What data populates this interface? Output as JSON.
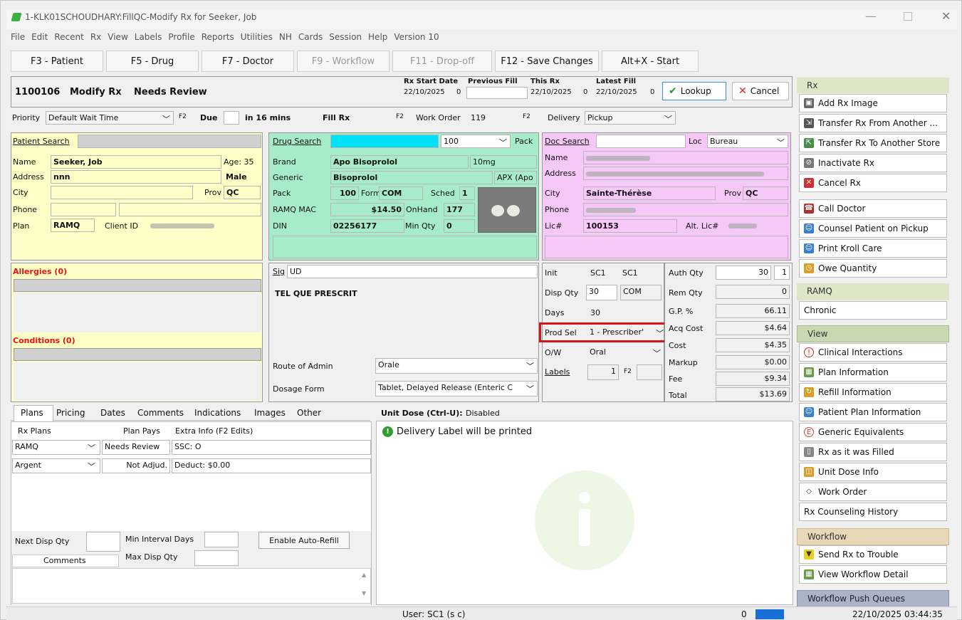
{
  "window": {
    "title": "1-KLK01SCHOUDHARY:FillQC-Modify Rx for Seeker, Job"
  },
  "menu": [
    "File",
    "Edit",
    "Recent",
    "Rx",
    "View",
    "Labels",
    "Profile",
    "Reports",
    "Utilities",
    "NH",
    "Cards",
    "Session",
    "Help",
    "Version 10"
  ],
  "fkeys": [
    "F3 - Patient",
    "F5 - Drug",
    "F7 - Doctor",
    "F9 - Workflow",
    "F11 - Drop-off",
    "F12 - Save Changes",
    "Alt+X - Start"
  ],
  "header": {
    "rx_number": "1100106",
    "mode": "Modify Rx",
    "status": "Needs Review",
    "rx_start_label": "Rx Start Date",
    "rx_start": "22/10/2025",
    "rx_start_n": "0",
    "prev_fill_label": "Previous Fill",
    "this_rx_label": "This Rx",
    "this_rx": "22/10/2025",
    "this_rx_n": "0",
    "latest_fill_label": "Latest Fill",
    "latest_fill": "22/10/2025",
    "latest_fill_n": "0",
    "lookup": "Lookup",
    "cancel": "Cancel"
  },
  "row2": {
    "priority_label": "Priority",
    "priority": "Default Wait Time",
    "f2": "F2",
    "due_label": "Due",
    "due": "in 16 mins",
    "fill_rx": "Fill Rx",
    "work_order_label": "Work Order",
    "work_order": "119",
    "delivery_label": "Delivery",
    "delivery": "Pickup"
  },
  "patient": {
    "search_label": "Patient Search",
    "name_label": "Name",
    "name": "Seeker, Job",
    "age": "Age: 35",
    "address_label": "Address",
    "address": "nnn",
    "sex": "Male",
    "city_label": "City",
    "prov_label": "Prov",
    "prov": "QC",
    "phone_label": "Phone",
    "plan_label": "Plan",
    "plan": "RAMQ",
    "client_id_label": "Client ID"
  },
  "drug": {
    "search_label": "Drug Search",
    "qty": "100",
    "pack_btn": "Pack",
    "brand_label": "Brand",
    "brand": "Apo Bisoprolol",
    "strength": "10mg",
    "generic_label": "Generic",
    "generic": "Bisoprolol",
    "mfr": "APX (Apo",
    "pack_label": "Pack",
    "pack": "100",
    "form_label": "Form",
    "form": "COM",
    "sched_label": "Sched",
    "sched": "1",
    "mac_label": "RAMQ MAC",
    "mac": "$14.50",
    "onhand_label": "OnHand",
    "onhand": "177",
    "din_label": "DIN",
    "din": "02256177",
    "minqty_label": "Min Qty",
    "minqty": "0"
  },
  "doctor": {
    "search_label": "Doc Search",
    "loc_label": "Loc",
    "loc": "Bureau",
    "name_label": "Name",
    "address_label": "Address",
    "city_label": "City",
    "city": "Sainte-Thérèse",
    "prov_label": "Prov",
    "prov": "QC",
    "phone_label": "Phone",
    "lic_label": "Lic#",
    "lic": "100153",
    "alt_lic_label": "Alt. Lic#"
  },
  "allergies": "Allergies (0)",
  "conditions": "Conditions (0)",
  "sig": {
    "label": "Sig",
    "code": "UD",
    "text": "TEL QUE PRESCRIT",
    "route_label": "Route of Admin",
    "route": "Orale",
    "dosage_label": "Dosage Form",
    "dosage": "Tablet, Delayed Release (Enteric C"
  },
  "disp": {
    "init_label": "Init",
    "init1": "SC1",
    "init2": "SC1",
    "disp_qty_label": "Disp Qty",
    "disp_qty": "30",
    "disp_unit": "COM",
    "days_label": "Days",
    "days": "30",
    "prod_sel_label": "Prod Sel",
    "prod_sel": "1 - Prescriber'",
    "ow_label": "O/W",
    "ow": "Oral",
    "labels_label": "Labels",
    "labels": "1",
    "f2": "F2"
  },
  "pricing": {
    "auth_qty_label": "Auth Qty",
    "auth_qty": "30",
    "auth_n": "1",
    "rem_qty_label": "Rem Qty",
    "rem_qty": "0",
    "gp_label": "G.P. %",
    "gp": "66.11",
    "acq_label": "Acq Cost",
    "acq": "$4.64",
    "cost_label": "Cost",
    "cost": "$4.35",
    "markup_label": "Markup",
    "markup": "$0.00",
    "fee_label": "Fee",
    "fee": "$9.34",
    "total_label": "Total",
    "total": "$13.69"
  },
  "tabs": [
    "Plans",
    "Pricing",
    "Dates",
    "Comments",
    "Indications",
    "Images",
    "Other"
  ],
  "plans": {
    "col1": "Rx Plans",
    "col2": "Plan Pays",
    "col3": "Extra Info (F2 Edits)",
    "rows": [
      {
        "plan": "RAMQ",
        "pays": "Needs Review",
        "info": "SSC: O"
      },
      {
        "plan": "Argent",
        "pays": "Not Adjud.",
        "info": "Deduct: $0.00"
      }
    ],
    "next_disp_label": "Next Disp Qty",
    "min_interval_label": "Min Interval Days",
    "max_disp_label": "Max Disp Qty",
    "auto_refill": "Enable Auto-Refill",
    "comments_label": "Comments"
  },
  "unit_dose": {
    "label": "Unit Dose (Ctrl-U):",
    "status": "Disabled",
    "message": "Delivery Label will be printed"
  },
  "sidebar": {
    "rx_hdr": "Rx",
    "rx_items": [
      "Add Rx Image",
      "Transfer Rx From Another ...",
      "Transfer Rx To Another Store",
      "Inactivate Rx",
      "Cancel Rx",
      "Call Doctor",
      "Counsel Patient on Pickup",
      "Print Kroll Care",
      "Owe Quantity"
    ],
    "ramq_hdr": "RAMQ",
    "ramq_items": [
      "Chronic"
    ],
    "view_hdr": "View",
    "view_items": [
      "Clinical Interactions",
      "Plan Information",
      "Refill Information",
      "Patient Plan Information",
      "Generic Equivalents",
      "Rx as it was Filled",
      "Unit Dose Info",
      "Work Order",
      "Rx Counseling History"
    ],
    "workflow_hdr": "Workflow",
    "workflow_items": [
      "Send Rx to Trouble",
      "View Workflow Detail"
    ],
    "push_hdr": "Workflow Push Queues"
  },
  "status": {
    "user": "User: SC1 (s c)",
    "count": "0",
    "datetime": "22/10/2025 03:44:35"
  }
}
